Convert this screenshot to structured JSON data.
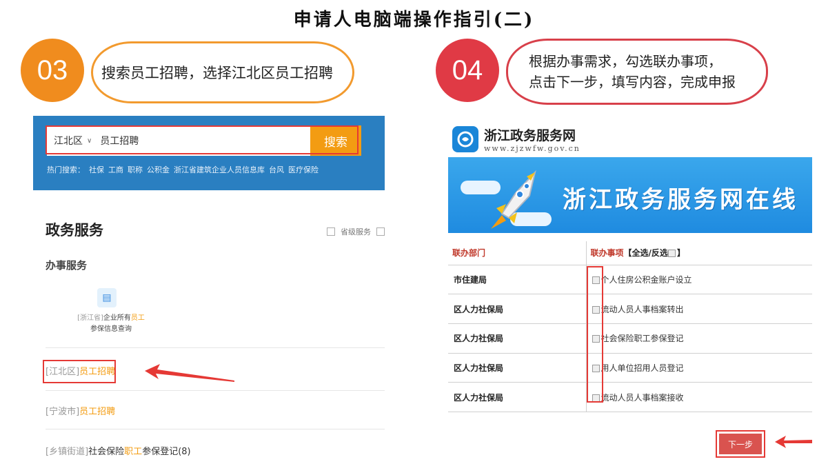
{
  "title": "申请人电脑端操作指引(二)",
  "steps": [
    {
      "number": "03",
      "text": "搜索员工招聘，选择江北区员工招聘",
      "color": "#f08c1e"
    },
    {
      "number": "04",
      "lines": [
        "根据办事需求，勾选联办事项，",
        "点击下一步，填写内容，完成申报"
      ],
      "color": "#e03a45"
    }
  ],
  "search": {
    "region": "江北区",
    "query": "员工招聘",
    "button": "搜索",
    "hot_label": "热门搜索：",
    "hot_items": [
      "社保",
      "工商",
      "职称",
      "公积金",
      "浙江省建筑企业人员信息库",
      "台风",
      "医疗保险"
    ]
  },
  "results": {
    "section_title": "政务服务",
    "filter_label": "省级服务",
    "sub_title": "办事服务",
    "service_card": {
      "prefix": "[浙江省]",
      "mid": "企业所有",
      "highlight": "员工",
      "line2": "参保信息查询"
    },
    "items": [
      {
        "region": "[江北区]",
        "name": "员工招聘"
      },
      {
        "region": "[宁波市]",
        "name": "员工招聘"
      },
      {
        "region": "[乡镇街道]",
        "pre": "社会保险",
        "name": "职工",
        "post": "参保登记(8)"
      }
    ]
  },
  "portal": {
    "name": "浙江政务服务网",
    "url": "www.zjzwfw.gov.cn",
    "banner": "浙江政务服务网在线"
  },
  "table": {
    "col_dept": "联办部门",
    "col_item": "联办事项",
    "select_all": "【全选/反选",
    "select_all_end": "】",
    "rows": [
      {
        "dept": "市住建局",
        "item": "个人住房公积金账户设立"
      },
      {
        "dept": "区人力社保局",
        "item": "流动人员人事档案转出"
      },
      {
        "dept": "区人力社保局",
        "item": "社会保险职工参保登记"
      },
      {
        "dept": "区人力社保局",
        "item": "用人单位招用人员登记"
      },
      {
        "dept": "区人力社保局",
        "item": "流动人员人事档案接收"
      }
    ]
  },
  "next_button": "下一步",
  "colors": {
    "accent_red": "#e53935",
    "search_band": "#2a7fc1",
    "orange": "#f39c12"
  }
}
